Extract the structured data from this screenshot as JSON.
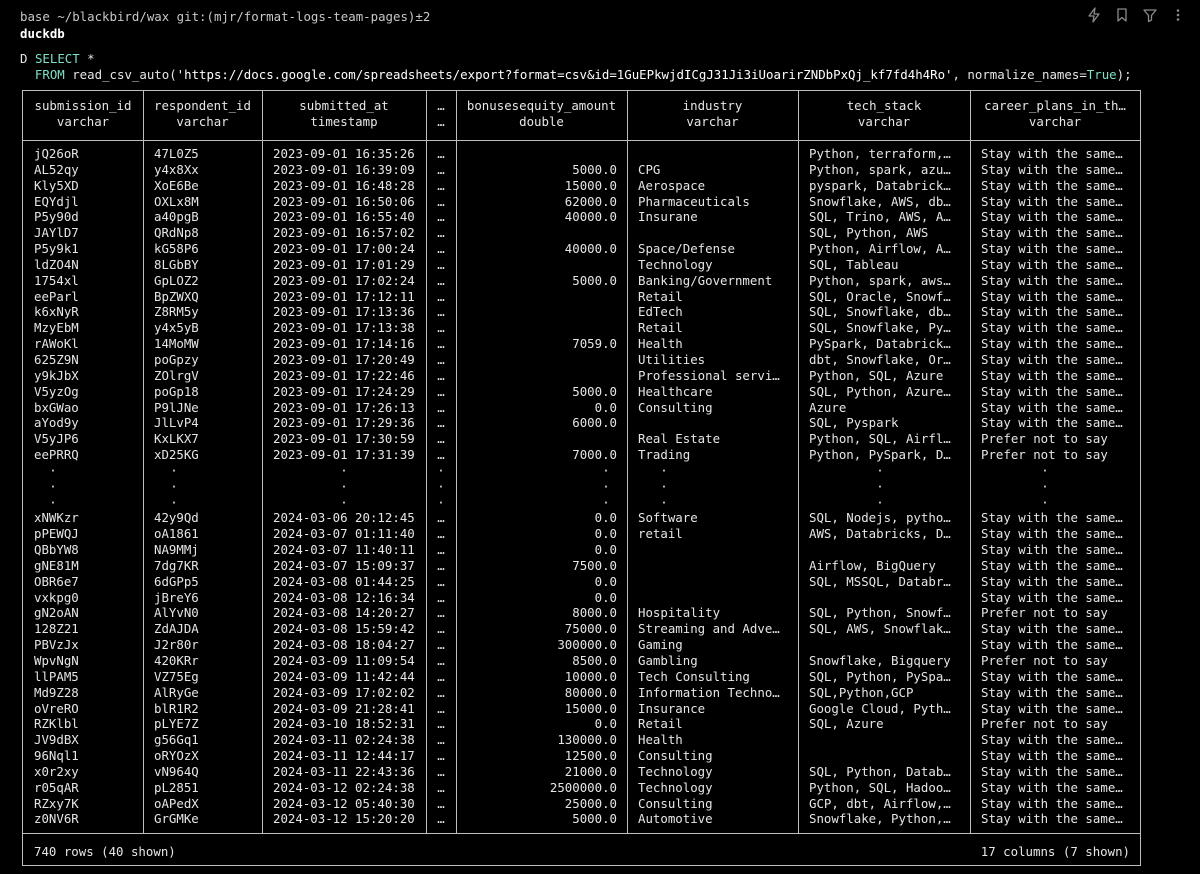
{
  "terminal": {
    "prompt": "base ~/blackbird/wax git:(mjr/format-logs-team-pages)±2",
    "title": "duckdb",
    "query_marker": "D",
    "query_select_kw": "SELECT",
    "query_select_rest": " *",
    "query_from_kw": "FROM",
    "query_from_fn": " read_csv_auto(",
    "query_url": "'https://docs.google.com/spreadsheets/export?format=csv&id=1GuEPkwjdICgJ31Ji3iUoarirZNDbPxQj_kf7fd4h4Ro'",
    "query_mid": ", normalize_names=",
    "query_bool": "True",
    "query_end": ");"
  },
  "toolbar_icons": [
    "bolt-icon",
    "bookmark-icon",
    "filter-icon",
    "more-icon"
  ],
  "table": {
    "columns": [
      {
        "name": "submission_id",
        "type": "varchar"
      },
      {
        "name": "respondent_id",
        "type": "varchar"
      },
      {
        "name": "submitted_at",
        "type": "timestamp"
      },
      {
        "name": "…",
        "type": "…"
      },
      {
        "name": "bonusesequity_amount",
        "type": "double"
      },
      {
        "name": "industry",
        "type": "varchar"
      },
      {
        "name": "tech_stack",
        "type": "varchar"
      },
      {
        "name": "career_plans_in_th…",
        "type": "varchar"
      }
    ],
    "rows_top": [
      [
        "jQ26oR",
        "47L0Z5",
        "2023-09-01 16:35:26",
        "…",
        "",
        "",
        "Python, terraform,…",
        "Stay with the same…"
      ],
      [
        "AL52qy",
        "y4x8Xx",
        "2023-09-01 16:39:09",
        "…",
        "5000.0",
        "CPG",
        "Python, spark, azu…",
        "Stay with the same…"
      ],
      [
        "Kly5XD",
        "XoE6Be",
        "2023-09-01 16:48:28",
        "…",
        "15000.0",
        "Aerospace",
        "pyspark, Databrick…",
        "Stay with the same…"
      ],
      [
        "EQYdjl",
        "OXLx8M",
        "2023-09-01 16:50:06",
        "…",
        "62000.0",
        "Pharmaceuticals",
        "Snowflake, AWS, db…",
        "Stay with the same…"
      ],
      [
        "P5y90d",
        "a40pgB",
        "2023-09-01 16:55:40",
        "…",
        "40000.0",
        "Insurane",
        "SQL, Trino, AWS, A…",
        "Stay with the same…"
      ],
      [
        "JAYlD7",
        "QRdNp8",
        "2023-09-01 16:57:02",
        "…",
        "",
        "",
        "SQL, Python, AWS",
        "Stay with the same…"
      ],
      [
        "P5y9k1",
        "kG58P6",
        "2023-09-01 17:00:24",
        "…",
        "40000.0",
        "Space/Defense",
        "Python, Airflow, A…",
        "Stay with the same…"
      ],
      [
        "ldZO4N",
        "8LGbBY",
        "2023-09-01 17:01:29",
        "…",
        "",
        "Technology",
        "SQL, Tableau",
        "Stay with the same…"
      ],
      [
        "1754xl",
        "GpLOZ2",
        "2023-09-01 17:02:24",
        "…",
        "5000.0",
        "Banking/Government",
        "Python, spark, aws…",
        "Stay with the same…"
      ],
      [
        "eeParl",
        "BpZWXQ",
        "2023-09-01 17:12:11",
        "…",
        "",
        "Retail",
        "SQL, Oracle, Snowf…",
        "Stay with the same…"
      ],
      [
        "k6xNyR",
        "Z8RM5y",
        "2023-09-01 17:13:36",
        "…",
        "",
        "EdTech",
        "SQL, Snowflake, db…",
        "Stay with the same…"
      ],
      [
        "MzyEbM",
        "y4x5yB",
        "2023-09-01 17:13:38",
        "…",
        "",
        "Retail",
        "SQL, Snowflake, Py…",
        "Stay with the same…"
      ],
      [
        "rAWoKl",
        "14MoMW",
        "2023-09-01 17:14:16",
        "…",
        "7059.0",
        "Health",
        "PySpark, Databrick…",
        "Stay with the same…"
      ],
      [
        "625Z9N",
        "poGpzy",
        "2023-09-01 17:20:49",
        "…",
        "",
        "Utilities",
        "dbt, Snowflake, Or…",
        "Stay with the same…"
      ],
      [
        "y9kJbX",
        "ZOlrgV",
        "2023-09-01 17:22:46",
        "…",
        "",
        "Professional servi…",
        "Python, SQL, Azure",
        "Stay with the same…"
      ],
      [
        "V5yzOg",
        "poGp18",
        "2023-09-01 17:24:29",
        "…",
        "5000.0",
        "Healthcare",
        "SQL, Python, Azure…",
        "Stay with the same…"
      ],
      [
        "bxGWao",
        "P9lJNe",
        "2023-09-01 17:26:13",
        "…",
        "0.0",
        "Consulting",
        "Azure",
        "Stay with the same…"
      ],
      [
        "aYod9y",
        "JlLvP4",
        "2023-09-01 17:29:36",
        "…",
        "6000.0",
        "",
        "SQL, Pyspark",
        "Stay with the same…"
      ],
      [
        "V5yJP6",
        "KxLKX7",
        "2023-09-01 17:30:59",
        "…",
        "",
        "Real Estate",
        "Python, SQL, Airfl…",
        "Prefer not to say"
      ],
      [
        "eePRRQ",
        "xD25KG",
        "2023-09-01 17:31:39",
        "…",
        "7000.0",
        "Trading",
        "Python, PySpark, D…",
        "Prefer not to say"
      ]
    ],
    "ellipsis_rows": [
      [
        "·",
        "·",
        "·",
        "·",
        "·",
        "·",
        "·",
        "·"
      ],
      [
        "·",
        "·",
        "·",
        "·",
        "·",
        "·",
        "·",
        "·"
      ],
      [
        "·",
        "·",
        "·",
        "·",
        "·",
        "·",
        "·",
        "·"
      ]
    ],
    "rows_bottom": [
      [
        "xNWKzr",
        "42y9Qd",
        "2024-03-06 20:12:45",
        "…",
        "0.0",
        "Software",
        "SQL, Nodejs, pytho…",
        "Stay with the same…"
      ],
      [
        "pPEWQJ",
        "oA1861",
        "2024-03-07 01:11:40",
        "…",
        "0.0",
        "retail",
        "AWS, Databricks, D…",
        "Stay with the same…"
      ],
      [
        "QBbYW8",
        "NA9MMj",
        "2024-03-07 11:40:11",
        "…",
        "0.0",
        "",
        "",
        "Stay with the same…"
      ],
      [
        "gNE81M",
        "7dg7KR",
        "2024-03-07 15:09:37",
        "…",
        "7500.0",
        "",
        "Airflow, BigQuery",
        "Stay with the same…"
      ],
      [
        "OBR6e7",
        "6dGPp5",
        "2024-03-08 01:44:25",
        "…",
        "0.0",
        "",
        "SQL, MSSQL, Databr…",
        "Stay with the same…"
      ],
      [
        "vxkpg0",
        "jBreY6",
        "2024-03-08 12:16:34",
        "…",
        "0.0",
        "",
        "",
        "Stay with the same…"
      ],
      [
        "gN2oAN",
        "AlYvN0",
        "2024-03-08 14:20:27",
        "…",
        "8000.0",
        "Hospitality",
        "SQL, Python, Snowf…",
        "Prefer not to say"
      ],
      [
        "128Z21",
        "ZdAJDA",
        "2024-03-08 15:59:42",
        "…",
        "75000.0",
        "Streaming and Adve…",
        "SQL, AWS, Snowflak…",
        "Stay with the same…"
      ],
      [
        "PBVzJx",
        "J2r80r",
        "2024-03-08 18:04:27",
        "…",
        "300000.0",
        "Gaming",
        "",
        "Stay with the same…"
      ],
      [
        "WpvNgN",
        "420KRr",
        "2024-03-09 11:09:54",
        "…",
        "8500.0",
        "Gambling",
        "Snowflake, Bigquery",
        "Prefer not to say"
      ],
      [
        "llPAM5",
        "VZ75Eg",
        "2024-03-09 11:42:44",
        "…",
        "10000.0",
        "Tech Consulting",
        "SQL, Python, PySpa…",
        "Stay with the same…"
      ],
      [
        "Md9Z28",
        "AlRyGe",
        "2024-03-09 17:02:02",
        "…",
        "80000.0",
        "Information Techno…",
        "SQL,Python,GCP",
        "Stay with the same…"
      ],
      [
        "oVreRO",
        "blR1R2",
        "2024-03-09 21:28:41",
        "…",
        "15000.0",
        "Insurance",
        "Google Cloud, Pyth…",
        "Stay with the same…"
      ],
      [
        "RZKlbl",
        "pLYE7Z",
        "2024-03-10 18:52:31",
        "…",
        "0.0",
        "Retail",
        "SQL, Azure",
        "Prefer not to say"
      ],
      [
        "JV9dBX",
        "g56Gq1",
        "2024-03-11 02:24:38",
        "…",
        "130000.0",
        "Health",
        "",
        "Stay with the same…"
      ],
      [
        "96Nql1",
        "oRYOzX",
        "2024-03-11 12:44:17",
        "…",
        "12500.0",
        "Consulting",
        "",
        "Stay with the same…"
      ],
      [
        "x0r2xy",
        "vN964Q",
        "2024-03-11 22:43:36",
        "…",
        "21000.0",
        "Technology",
        "SQL, Python, Datab…",
        "Stay with the same…"
      ],
      [
        "r05qAR",
        "pL2851",
        "2024-03-12 02:24:38",
        "…",
        "2500000.0",
        "Technology",
        "Python, SQL, Hadoo…",
        "Stay with the same…"
      ],
      [
        "RZxy7K",
        "oAPedX",
        "2024-03-12 05:40:30",
        "…",
        "25000.0",
        "Consulting",
        "GCP, dbt, Airflow,…",
        "Stay with the same…"
      ],
      [
        "z0NV6R",
        "GrGMKe",
        "2024-03-12 15:20:20",
        "…",
        "5000.0",
        "Automotive",
        "Snowflake, Python,…",
        "Stay with the same…"
      ]
    ],
    "footer_left": "740 rows (40 shown)",
    "footer_right": "17 columns (7 shown)"
  }
}
